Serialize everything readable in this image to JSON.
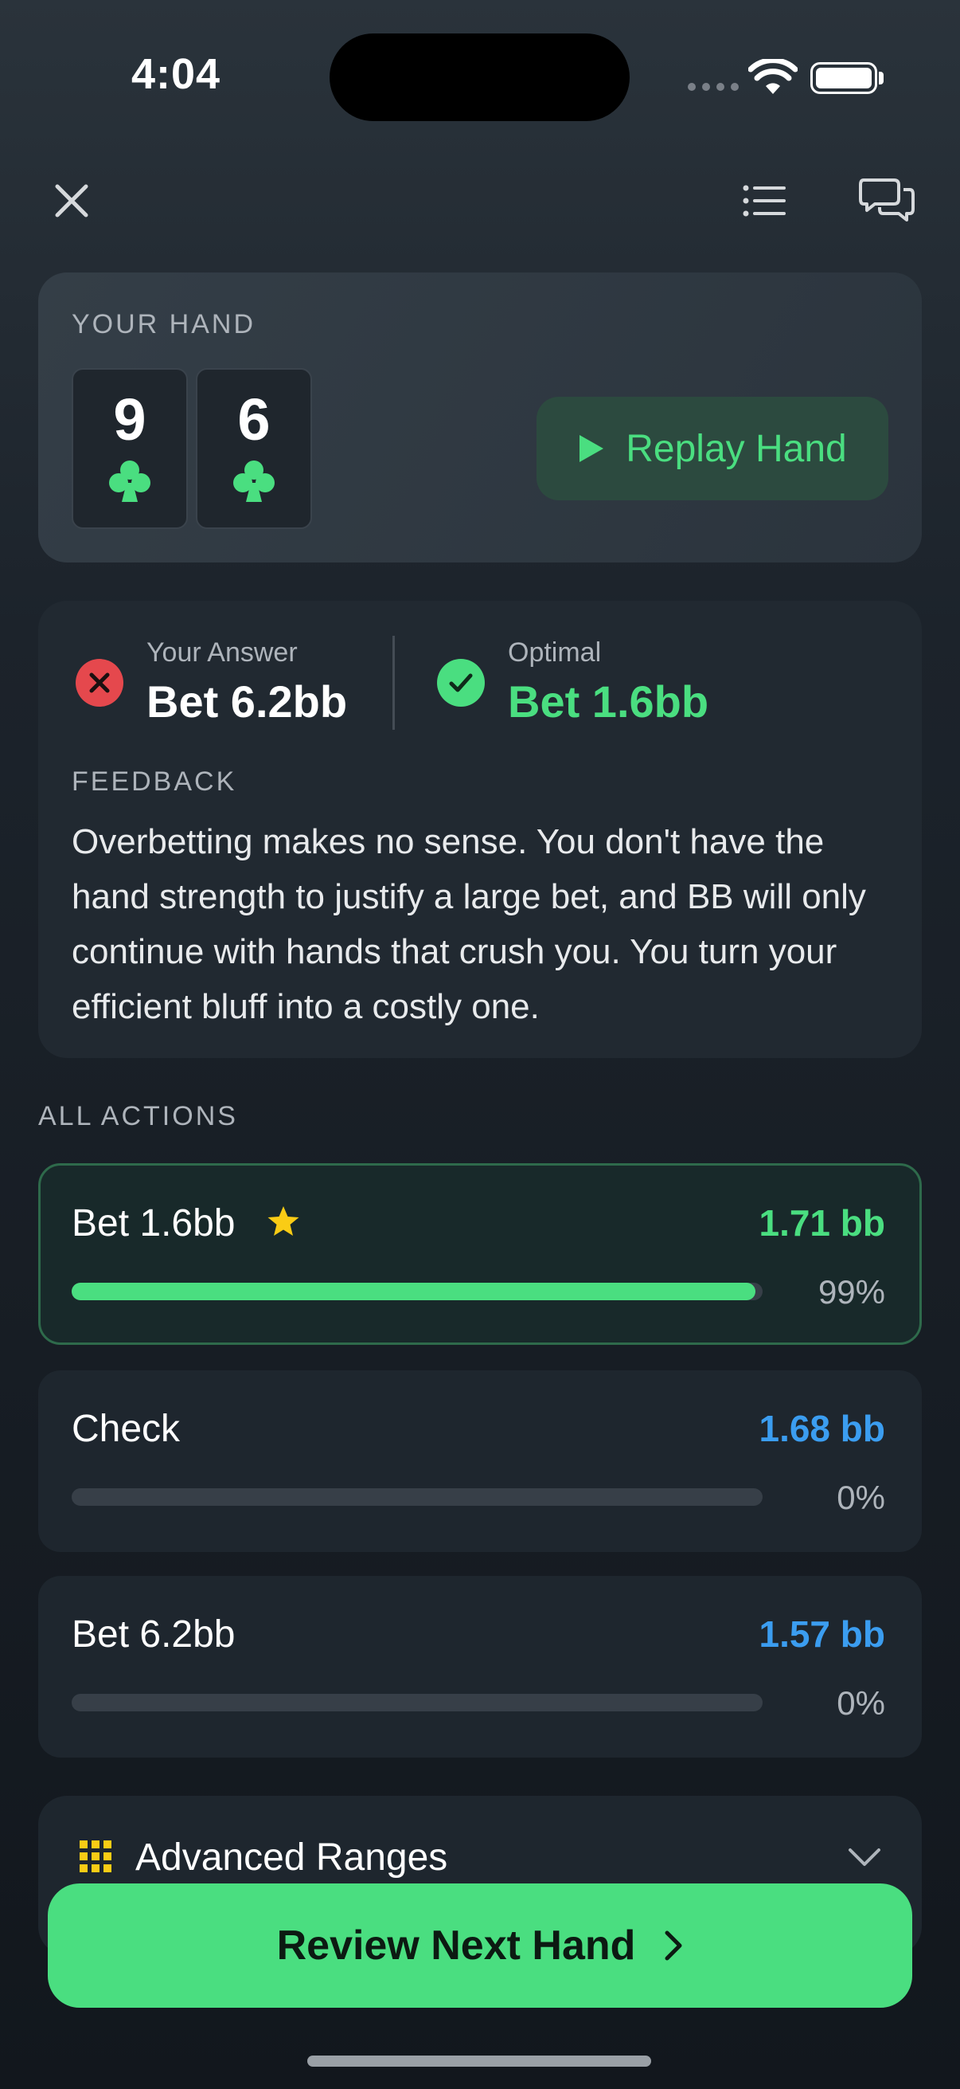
{
  "status_bar": {
    "time": "4:04"
  },
  "hand": {
    "section_label": "YOUR HAND",
    "cards": [
      {
        "rank": "9",
        "suit": "club-icon"
      },
      {
        "rank": "6",
        "suit": "club-icon"
      }
    ],
    "replay_label": "Replay Hand"
  },
  "answer": {
    "your_label": "Your Answer",
    "your_value": "Bet 6.2bb",
    "optimal_label": "Optimal",
    "optimal_value": "Bet 1.6bb",
    "feedback_label": "FEEDBACK",
    "feedback_text": "Overbetting makes no sense. You don't have the hand strength to justify a large bet, and BB will only continue with hands that crush you. You turn your efficient bluff into a costly one."
  },
  "actions": {
    "section_label": "ALL ACTIONS",
    "items": [
      {
        "label": "Bet 1.6bb",
        "ev": "1.71 bb",
        "pct": "99%",
        "frequency": 0.99,
        "best": true
      },
      {
        "label": "Check",
        "ev": "1.68 bb",
        "pct": "0%",
        "frequency": 0.0,
        "best": false
      },
      {
        "label": "Bet 6.2bb",
        "ev": "1.57 bb",
        "pct": "0%",
        "frequency": 0.0,
        "best": false
      }
    ]
  },
  "advanced": {
    "label": "Advanced Ranges"
  },
  "footer": {
    "review_label": "Review Next Hand"
  },
  "colors": {
    "accent_green": "#4ade80",
    "ev_blue": "#3b9df0",
    "error_red": "#e5484d",
    "star_yellow": "#facc15"
  }
}
